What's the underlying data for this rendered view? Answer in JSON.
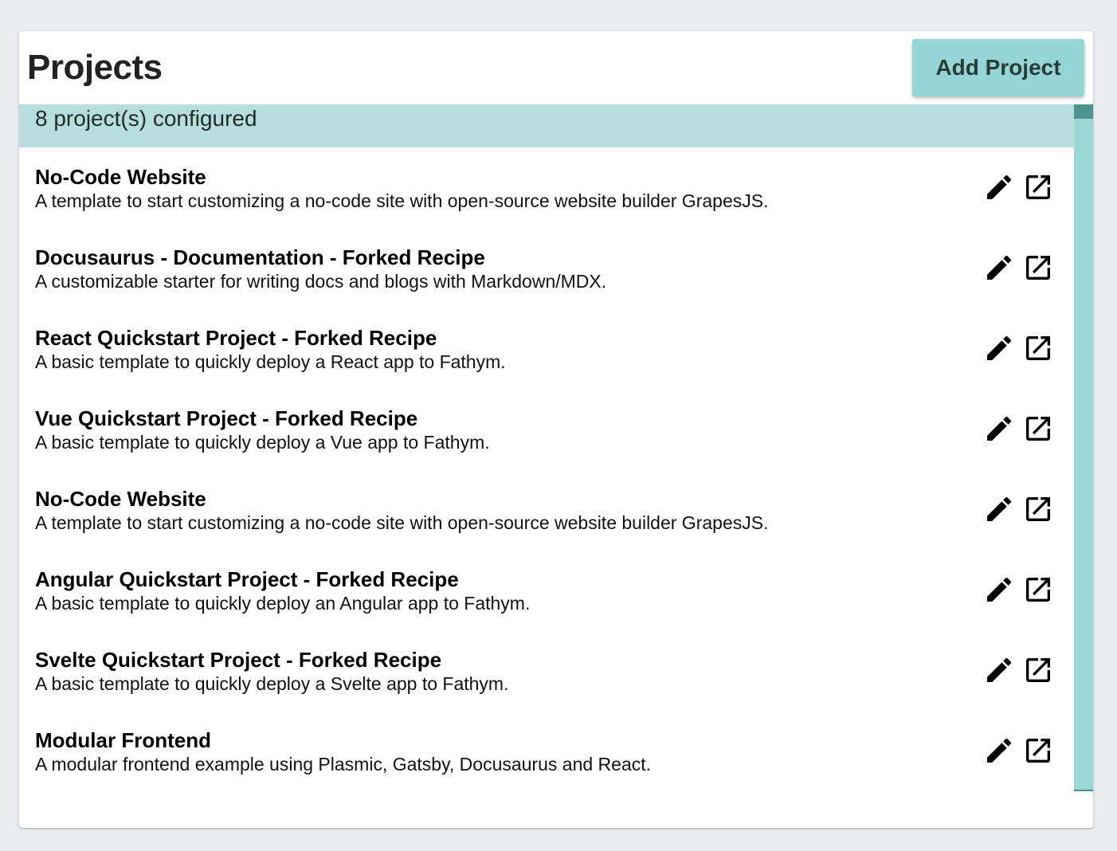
{
  "header": {
    "title": "Projects",
    "add_button_label": "Add Project"
  },
  "status": {
    "text": "8 project(s) configured"
  },
  "icons": {
    "edit": "pencil-icon",
    "open": "open-in-new-icon"
  },
  "colors": {
    "accent": "#94d6d6",
    "status_bar": "#b7dddd",
    "scrollbar_track": "#9ad7d5",
    "scrollbar_thumb": "#4d9390",
    "background": "#ebecef"
  },
  "projects": [
    {
      "name": "No-Code Website",
      "description": "A template to start customizing a no-code site with open-source website builder GrapesJS."
    },
    {
      "name": "Docusaurus - Documentation - Forked Recipe",
      "description": "A customizable starter for writing docs and blogs with Markdown/MDX."
    },
    {
      "name": "React Quickstart Project - Forked Recipe",
      "description": "A basic template to quickly deploy a React app to Fathym."
    },
    {
      "name": "Vue Quickstart Project - Forked Recipe",
      "description": "A basic template to quickly deploy a Vue app to Fathym."
    },
    {
      "name": "No-Code Website",
      "description": "A template to start customizing a no-code site with open-source website builder GrapesJS."
    },
    {
      "name": "Angular Quickstart Project - Forked Recipe",
      "description": "A basic template to quickly deploy an Angular app to Fathym."
    },
    {
      "name": "Svelte Quickstart Project - Forked Recipe",
      "description": "A basic template to quickly deploy a Svelte app to Fathym."
    },
    {
      "name": "Modular Frontend",
      "description": "A modular frontend example using Plasmic, Gatsby, Docusaurus and React."
    }
  ]
}
